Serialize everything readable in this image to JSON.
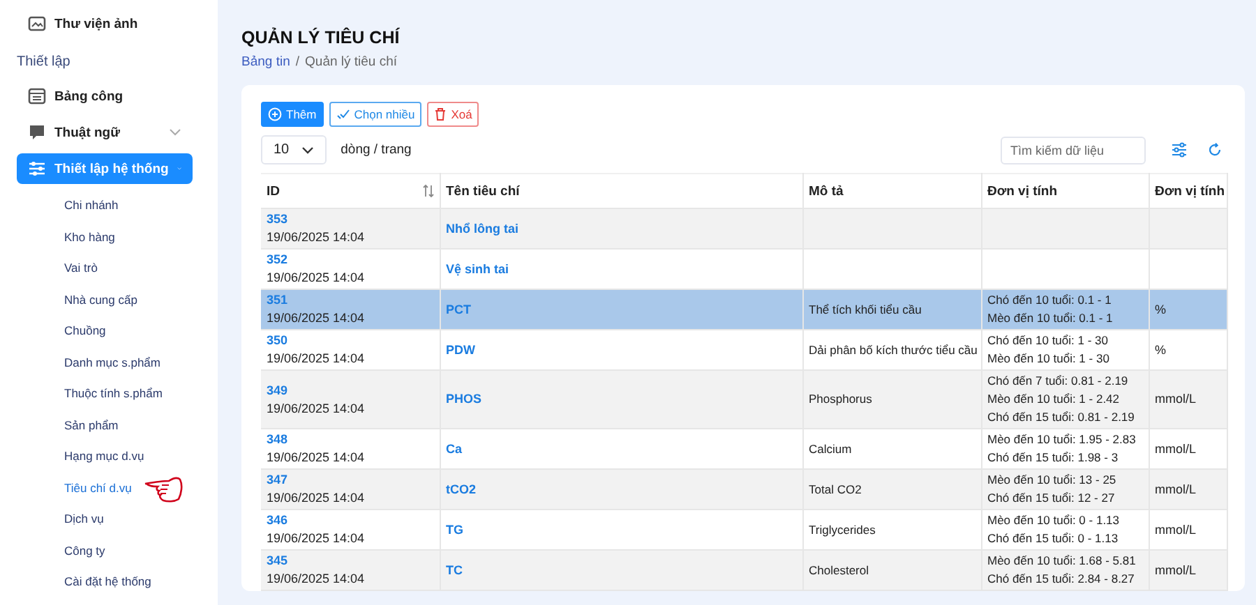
{
  "sidebar": {
    "top_item": {
      "label": "Thư viện ảnh"
    },
    "section": "Thiết lập",
    "items": [
      {
        "label": "Bảng công",
        "expandable": false,
        "selected": false
      },
      {
        "label": "Thuật ngữ",
        "expandable": true,
        "selected": false
      },
      {
        "label": "Thiết lập hệ thống",
        "expandable": true,
        "selected": true
      }
    ],
    "submenu": [
      {
        "label": "Chi nhánh",
        "selected": false
      },
      {
        "label": "Kho hàng",
        "selected": false
      },
      {
        "label": "Vai trò",
        "selected": false
      },
      {
        "label": "Nhà cung cấp",
        "selected": false
      },
      {
        "label": "Chuồng",
        "selected": false
      },
      {
        "label": "Danh mục s.phẩm",
        "selected": false
      },
      {
        "label": "Thuộc tính s.phẩm",
        "selected": false
      },
      {
        "label": "Sản phẩm",
        "selected": false
      },
      {
        "label": "Hạng mục d.vụ",
        "selected": false
      },
      {
        "label": "Tiêu chí d.vụ",
        "selected": true
      },
      {
        "label": "Dịch vụ",
        "selected": false
      },
      {
        "label": "Công ty",
        "selected": false
      },
      {
        "label": "Cài đặt hệ thống",
        "selected": false
      }
    ]
  },
  "page": {
    "title": "QUẢN LÝ TIÊU CHÍ",
    "breadcrumb": [
      {
        "label": "Bảng tin",
        "kind": "link"
      },
      {
        "label": "/",
        "kind": "separator"
      },
      {
        "label": "Quản lý tiêu chí",
        "kind": "current"
      }
    ]
  },
  "toolbar": {
    "buttons": [
      {
        "label": "Thêm",
        "kind": "primary"
      },
      {
        "label": "Chọn nhiều",
        "kind": "outline"
      },
      {
        "label": "Xoá",
        "kind": "danger"
      }
    ],
    "page_size": "10",
    "page_size_label": "dòng / trang",
    "search": {
      "placeholder": "Tìm kiếm dữ liệu"
    }
  },
  "table": {
    "columns": [
      "ID",
      "Tên tiêu chí",
      "Mô tả",
      "Đơn vị tính",
      "Đơn vị tính"
    ],
    "rows": [
      {
        "id": "353",
        "date": "19/06/2025 14:04",
        "name": "Nhổ lông tai",
        "description": "",
        "ranges": [],
        "unit": "",
        "selected": false
      },
      {
        "id": "352",
        "date": "19/06/2025 14:04",
        "name": "Vệ sinh tai",
        "description": "",
        "ranges": [],
        "unit": "",
        "selected": false
      },
      {
        "id": "351",
        "date": "19/06/2025 14:04",
        "name": "PCT",
        "description": "Thể tích khối tiểu cầu",
        "ranges": [
          "Chó đến 10 tuổi: 0.1 - 1",
          "Mèo đến 10 tuổi: 0.1 - 1"
        ],
        "unit": "%",
        "selected": true
      },
      {
        "id": "350",
        "date": "19/06/2025 14:04",
        "name": "PDW",
        "description": "Dải phân bố kích thước tiểu cầu",
        "ranges": [
          "Chó đến 10 tuổi: 1 - 30",
          "Mèo đến 10 tuổi: 1 - 30"
        ],
        "unit": "%",
        "selected": false
      },
      {
        "id": "349",
        "date": "19/06/2025 14:04",
        "name": "PHOS",
        "description": "Phosphorus",
        "ranges": [
          "Chó đến 7 tuổi: 0.81 - 2.19",
          "Mèo đến 10 tuổi: 1 - 2.42",
          "Chó đến 15 tuổi: 0.81 - 2.19"
        ],
        "unit": "mmol/L",
        "selected": false
      },
      {
        "id": "348",
        "date": "19/06/2025 14:04",
        "name": "Ca",
        "description": "Calcium",
        "ranges": [
          "Mèo đến 10 tuổi: 1.95 - 2.83",
          "Chó đến 15 tuổi: 1.98 - 3"
        ],
        "unit": "mmol/L",
        "selected": false
      },
      {
        "id": "347",
        "date": "19/06/2025 14:04",
        "name": "tCO2",
        "description": "Total CO2",
        "ranges": [
          "Mèo đến 10 tuổi: 13 - 25",
          "Chó đến 15 tuổi: 12 - 27"
        ],
        "unit": "mmol/L",
        "selected": false
      },
      {
        "id": "346",
        "date": "19/06/2025 14:04",
        "name": "TG",
        "description": "Triglycerides",
        "ranges": [
          "Mèo đến 10 tuổi: 0 - 1.13",
          "Chó đến 15 tuổi: 0 - 1.13"
        ],
        "unit": "mmol/L",
        "selected": false
      },
      {
        "id": "345",
        "date": "19/06/2025 14:04",
        "name": "TC",
        "description": "Cholesterol",
        "ranges": [
          "Mèo đến 10 tuổi: 1.68 - 5.81",
          "Chó đến 15 tuổi: 2.84 - 8.27"
        ],
        "unit": "mmol/L",
        "selected": false
      }
    ]
  }
}
